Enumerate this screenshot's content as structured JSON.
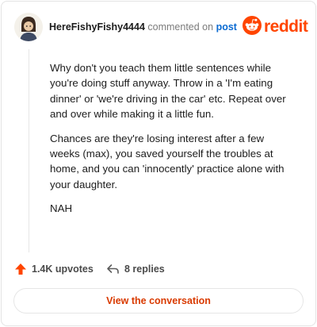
{
  "header": {
    "username": "HereFishyFishy4444",
    "commented_on": "commented on",
    "post_link": "post",
    "logo_text": "reddit"
  },
  "comment": {
    "paragraphs": [
      "Why don't you teach them little sentences while you're doing stuff anyway. Throw in a 'I'm eating dinner' or 'we're driving in the car' etc. Repeat over and over while making it a little fun.",
      "Chances are they're losing interest after a few weeks (max), you saved yourself the troubles at home, and you can 'innocently' practice alone with your daughter.",
      "NAH"
    ]
  },
  "actions": {
    "upvotes": "1.4K upvotes",
    "replies": "8 replies"
  },
  "view_button": "View the conversation",
  "colors": {
    "brand": "#ff4500",
    "link": "#0a6ad1",
    "button_text": "#d93a00"
  }
}
